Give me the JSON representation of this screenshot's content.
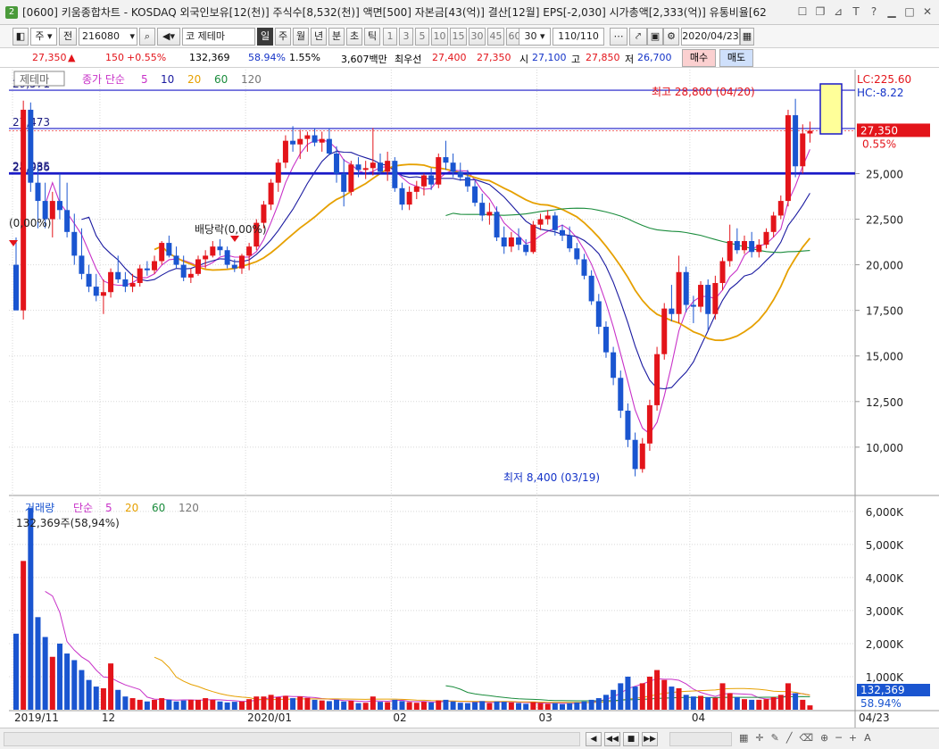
{
  "window": {
    "badge": "2",
    "title": "[0600] 키움종합차트 - KOSDAQ 외국인보유[12(천)] 주식수[8,532(천)] 액면[500] 자본금[43(억)] 결산[12월] EPS[-2,030] 시가총액[2,333(억)] 유통비율[62"
  },
  "toolbar": {
    "market": "주",
    "prev": "전",
    "code": "216080",
    "market2": "코",
    "theme": "제테마",
    "periods": [
      "일",
      "주",
      "월",
      "년",
      "분",
      "초",
      "틱"
    ],
    "active_period": "일",
    "intervals": [
      "1",
      "3",
      "5",
      "10",
      "15",
      "30",
      "45",
      "60"
    ],
    "interval_value": "30",
    "count": "110/110",
    "date": "2020/04/23"
  },
  "quote": {
    "price": "27,350",
    "change": "150",
    "change_pct": "+0.55%",
    "volume": "132,369",
    "vol_ratio": "58.94%",
    "turnover": "1.55%",
    "amount": "3,607백만",
    "label_best": "최우선",
    "best_ask": "27,400",
    "best_bid": "27,350",
    "label_open": "시",
    "open": "27,100",
    "label_high": "고",
    "high": "27,850",
    "label_low": "저",
    "low": "26,700",
    "buy_btn": "매수",
    "sell_btn": "매도"
  },
  "price_panel": {
    "legend_tab": "제테마",
    "legend_label": "종가 단순",
    "ma_labels": [
      "5",
      "10",
      "20",
      "60",
      "120"
    ],
    "ma_colors": [
      "#c832c8",
      "#1a1aa0",
      "#e6a000",
      "#1a8c3c",
      "#777777"
    ],
    "lc": "LC:225.60",
    "hc": "HC:-8.22",
    "current_price": "27,350",
    "current_pct": "0.55%",
    "y_ticks": [
      "25,000",
      "22,500",
      "20,000",
      "17,500",
      "15,000",
      "12,500",
      "10,000"
    ],
    "hlines": [
      {
        "label": "29,571",
        "value": 29571
      },
      {
        "label": "27,473",
        "value": 27473
      },
      {
        "label": "25,035",
        "value": 25035
      },
      {
        "label": "24,986",
        "value": 24986
      }
    ],
    "annot_high": "최고 28,800 (04/20)",
    "annot_low": "최저 8,400 (03/19)",
    "annot_div": "배당락(0,00%)",
    "annot_left": "(0,00%)",
    "up_color": "#e3141a",
    "down_color": "#1a55d0"
  },
  "volume_panel": {
    "label": "거래량",
    "legend_label": "단순",
    "ma_labels": [
      "5",
      "20",
      "60",
      "120"
    ],
    "current": "132,369주(58,94%)",
    "y_ticks": [
      "6,000K",
      "5,000K",
      "4,000K",
      "3,000K",
      "2,000K",
      "1,000K"
    ],
    "current_value": "132,369",
    "current_pct": "58.94%"
  },
  "x_axis": {
    "labels": [
      "2019/11",
      "12",
      "2020/01",
      "02",
      "03",
      "04"
    ],
    "end_label": "04/23"
  },
  "chart_data": {
    "type": "candlestick",
    "title": "",
    "y_range": [
      7400,
      30700
    ],
    "volume_range": [
      0,
      6400
    ],
    "volume_unit": "K",
    "candles": [
      [
        20000,
        21500,
        17500,
        17500,
        2300
      ],
      [
        17500,
        29000,
        17000,
        28500,
        4500
      ],
      [
        28500,
        28900,
        24000,
        24500,
        6100
      ],
      [
        24500,
        25500,
        22000,
        23500,
        2800
      ],
      [
        23500,
        24500,
        22000,
        22500,
        2200
      ],
      [
        22500,
        24000,
        21500,
        23500,
        1600
      ],
      [
        23500,
        25000,
        22500,
        23000,
        2000
      ],
      [
        23000,
        24500,
        21500,
        21800,
        1700
      ],
      [
        21800,
        22800,
        20000,
        20500,
        1500
      ],
      [
        20500,
        22000,
        19200,
        19500,
        1200
      ],
      [
        19500,
        20000,
        18500,
        18800,
        900
      ],
      [
        18800,
        19500,
        18000,
        18300,
        700
      ],
      [
        18300,
        19200,
        17300,
        18500,
        650
      ],
      [
        18500,
        19800,
        18200,
        19600,
        1400
      ],
      [
        19600,
        20500,
        19000,
        19200,
        600
      ],
      [
        19200,
        19600,
        18500,
        18800,
        400
      ],
      [
        18800,
        19500,
        18500,
        19000,
        350
      ],
      [
        19000,
        20000,
        18800,
        19800,
        300
      ],
      [
        19800,
        20200,
        19400,
        19700,
        250
      ],
      [
        19700,
        20500,
        19500,
        20200,
        300
      ],
      [
        20200,
        21300,
        20000,
        21200,
        350
      ],
      [
        21200,
        21600,
        20400,
        20500,
        300
      ],
      [
        20500,
        21000,
        19800,
        20000,
        250
      ],
      [
        20000,
        20500,
        19100,
        19300,
        280
      ],
      [
        19300,
        19800,
        19000,
        19500,
        300
      ],
      [
        19500,
        20500,
        19400,
        20300,
        300
      ],
      [
        20300,
        20800,
        19800,
        20500,
        350
      ],
      [
        20500,
        21300,
        20400,
        21000,
        300
      ],
      [
        21000,
        21400,
        20500,
        20800,
        250
      ],
      [
        20800,
        21000,
        19800,
        20000,
        220
      ],
      [
        20000,
        20300,
        19600,
        19800,
        240
      ],
      [
        19800,
        20600,
        19500,
        20500,
        250
      ],
      [
        20500,
        21200,
        19700,
        21000,
        320
      ],
      [
        21000,
        22500,
        20800,
        22300,
        400
      ],
      [
        22300,
        23500,
        22000,
        23300,
        400
      ],
      [
        23300,
        24700,
        23000,
        24500,
        450
      ],
      [
        24500,
        25800,
        24000,
        25600,
        380
      ],
      [
        25600,
        27100,
        25300,
        26800,
        420
      ],
      [
        26800,
        27600,
        26200,
        26600,
        350
      ],
      [
        26600,
        27400,
        25800,
        26900,
        400
      ],
      [
        26900,
        27300,
        26200,
        27100,
        360
      ],
      [
        27100,
        27500,
        26500,
        26700,
        300
      ],
      [
        26700,
        27300,
        26200,
        26900,
        280
      ],
      [
        26900,
        27500,
        26000,
        26100,
        260
      ],
      [
        26100,
        26500,
        24500,
        25000,
        300
      ],
      [
        25000,
        25800,
        23200,
        24000,
        250
      ],
      [
        24000,
        25700,
        23800,
        25500,
        270
      ],
      [
        25500,
        25900,
        24800,
        25200,
        200
      ],
      [
        25200,
        25700,
        24700,
        25300,
        210
      ],
      [
        25300,
        27500,
        24900,
        25600,
        400
      ],
      [
        25600,
        26100,
        25000,
        25100,
        240
      ],
      [
        25100,
        26200,
        24600,
        25700,
        230
      ],
      [
        25700,
        25900,
        24000,
        24200,
        300
      ],
      [
        24200,
        24500,
        23000,
        23300,
        260
      ],
      [
        23300,
        24300,
        23000,
        24000,
        230
      ],
      [
        24000,
        24600,
        23600,
        24300,
        210
      ],
      [
        24300,
        25000,
        23800,
        24900,
        240
      ],
      [
        24900,
        25300,
        24100,
        24400,
        220
      ],
      [
        24400,
        26100,
        24200,
        25900,
        280
      ],
      [
        25900,
        26800,
        25200,
        25600,
        300
      ],
      [
        25600,
        26100,
        24800,
        25100,
        250
      ],
      [
        25100,
        25600,
        24600,
        24800,
        210
      ],
      [
        24800,
        25200,
        24000,
        24300,
        200
      ],
      [
        24300,
        24600,
        23200,
        23400,
        230
      ],
      [
        23400,
        23900,
        22400,
        22700,
        260
      ],
      [
        22700,
        23400,
        22200,
        22900,
        200
      ],
      [
        22900,
        23200,
        21300,
        21500,
        250
      ],
      [
        21500,
        22100,
        20600,
        21000,
        240
      ],
      [
        21000,
        21800,
        20700,
        21500,
        220
      ],
      [
        21500,
        22000,
        20800,
        21100,
        200
      ],
      [
        21100,
        21400,
        20500,
        20700,
        180
      ],
      [
        20700,
        22400,
        20600,
        22200,
        230
      ],
      [
        22200,
        22800,
        21900,
        22500,
        200
      ],
      [
        22500,
        23000,
        22200,
        22700,
        180
      ],
      [
        22700,
        22900,
        21600,
        21900,
        200
      ],
      [
        21900,
        22200,
        21300,
        21600,
        170
      ],
      [
        21600,
        22100,
        20700,
        20900,
        200
      ],
      [
        20900,
        21200,
        20000,
        20300,
        220
      ],
      [
        20300,
        20600,
        19200,
        19400,
        250
      ],
      [
        19400,
        19700,
        17800,
        18000,
        300
      ],
      [
        18000,
        18400,
        16200,
        16600,
        350
      ],
      [
        16600,
        16900,
        14900,
        15200,
        450
      ],
      [
        15200,
        15500,
        13400,
        13800,
        600
      ],
      [
        13800,
        14200,
        11600,
        12000,
        800
      ],
      [
        12000,
        12400,
        10000,
        10400,
        1000
      ],
      [
        10400,
        10800,
        8400,
        8800,
        700
      ],
      [
        8800,
        10500,
        8600,
        10200,
        800
      ],
      [
        10200,
        12600,
        9800,
        12300,
        1000
      ],
      [
        12300,
        15500,
        12000,
        15100,
        1200
      ],
      [
        15100,
        17900,
        14800,
        17600,
        900
      ],
      [
        17600,
        18900,
        16900,
        17300,
        700
      ],
      [
        17300,
        20500,
        16800,
        19600,
        650
      ],
      [
        19600,
        19900,
        17400,
        17800,
        450
      ],
      [
        17800,
        18300,
        16800,
        17700,
        400
      ],
      [
        17700,
        19100,
        17400,
        18900,
        420
      ],
      [
        18900,
        19200,
        16400,
        17300,
        380
      ],
      [
        17300,
        19400,
        17000,
        19000,
        360
      ],
      [
        19000,
        20400,
        18600,
        20200,
        800
      ],
      [
        20200,
        22200,
        19900,
        21300,
        500
      ],
      [
        21300,
        22000,
        20600,
        20800,
        380
      ],
      [
        20800,
        21600,
        20600,
        21300,
        320
      ],
      [
        21300,
        21800,
        20400,
        20700,
        300
      ],
      [
        20700,
        21400,
        20400,
        21100,
        300
      ],
      [
        21100,
        22000,
        20900,
        21800,
        320
      ],
      [
        21800,
        22900,
        21500,
        22700,
        380
      ],
      [
        22700,
        23800,
        22500,
        23500,
        450
      ],
      [
        23500,
        28500,
        23200,
        28200,
        800
      ],
      [
        28200,
        29100,
        24800,
        25400,
        500
      ],
      [
        25400,
        27700,
        25000,
        27200,
        300
      ],
      [
        27200,
        27850,
        26700,
        27350,
        132
      ]
    ]
  }
}
